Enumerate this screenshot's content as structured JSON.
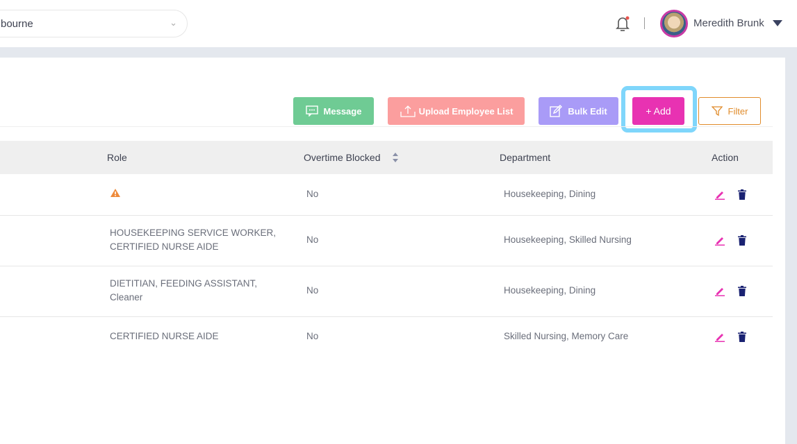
{
  "header": {
    "location": "Melbourne",
    "location_visible": "bourne",
    "user_name": "Meredith Brunk"
  },
  "toolbar": {
    "message": "Message",
    "upload": "Upload Employee List",
    "bulk_edit": "Bulk Edit",
    "add": "+ Add",
    "filter": "Filter"
  },
  "colors": {
    "message": "#6fcb94",
    "upload": "#fb9e9e",
    "bulk_edit": "#a99bf7",
    "add": "#e832b2",
    "filter": "#e08b2a",
    "highlight": "#7fd6fb"
  },
  "table": {
    "headers": {
      "role": "Role",
      "overtime": "Overtime Blocked",
      "department": "Department",
      "action": "Action"
    },
    "rows": [
      {
        "role_line1": "",
        "role_line2": "",
        "role_warning": true,
        "overtime": "No",
        "department": "Housekeeping, Dining"
      },
      {
        "role_line1": "HOUSEKEEPING SERVICE WORKER,",
        "role_line2": "CERTIFIED NURSE AIDE",
        "overtime": "No",
        "department": "Housekeeping, Skilled Nursing"
      },
      {
        "role_line1": "DIETITIAN, FEEDING ASSISTANT,",
        "role_line2": "Cleaner",
        "overtime": "No",
        "department": "Housekeeping, Dining"
      },
      {
        "role_line1": "CERTIFIED NURSE AIDE",
        "role_line2": "",
        "overtime": "No",
        "department": "Skilled Nursing, Memory Care"
      }
    ]
  }
}
